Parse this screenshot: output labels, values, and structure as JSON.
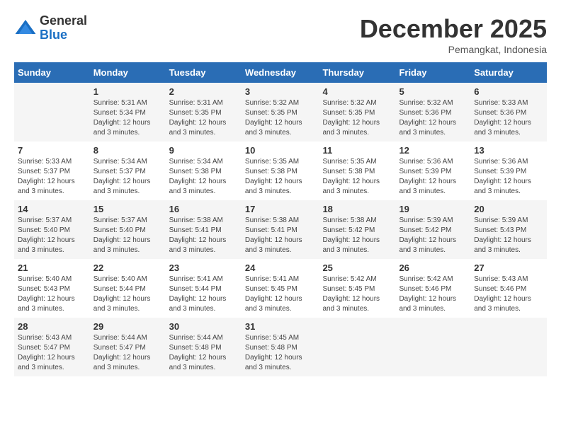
{
  "logo": {
    "general": "General",
    "blue": "Blue"
  },
  "title": "December 2025",
  "location": "Pemangkat, Indonesia",
  "days_header": [
    "Sunday",
    "Monday",
    "Tuesday",
    "Wednesday",
    "Thursday",
    "Friday",
    "Saturday"
  ],
  "rows": [
    [
      {
        "num": "",
        "info": ""
      },
      {
        "num": "1",
        "info": "Sunrise: 5:31 AM\nSunset: 5:34 PM\nDaylight: 12 hours\nand 3 minutes."
      },
      {
        "num": "2",
        "info": "Sunrise: 5:31 AM\nSunset: 5:35 PM\nDaylight: 12 hours\nand 3 minutes."
      },
      {
        "num": "3",
        "info": "Sunrise: 5:32 AM\nSunset: 5:35 PM\nDaylight: 12 hours\nand 3 minutes."
      },
      {
        "num": "4",
        "info": "Sunrise: 5:32 AM\nSunset: 5:35 PM\nDaylight: 12 hours\nand 3 minutes."
      },
      {
        "num": "5",
        "info": "Sunrise: 5:32 AM\nSunset: 5:36 PM\nDaylight: 12 hours\nand 3 minutes."
      },
      {
        "num": "6",
        "info": "Sunrise: 5:33 AM\nSunset: 5:36 PM\nDaylight: 12 hours\nand 3 minutes."
      }
    ],
    [
      {
        "num": "7",
        "info": "Sunrise: 5:33 AM\nSunset: 5:37 PM\nDaylight: 12 hours\nand 3 minutes."
      },
      {
        "num": "8",
        "info": "Sunrise: 5:34 AM\nSunset: 5:37 PM\nDaylight: 12 hours\nand 3 minutes."
      },
      {
        "num": "9",
        "info": "Sunrise: 5:34 AM\nSunset: 5:38 PM\nDaylight: 12 hours\nand 3 minutes."
      },
      {
        "num": "10",
        "info": "Sunrise: 5:35 AM\nSunset: 5:38 PM\nDaylight: 12 hours\nand 3 minutes."
      },
      {
        "num": "11",
        "info": "Sunrise: 5:35 AM\nSunset: 5:38 PM\nDaylight: 12 hours\nand 3 minutes."
      },
      {
        "num": "12",
        "info": "Sunrise: 5:36 AM\nSunset: 5:39 PM\nDaylight: 12 hours\nand 3 minutes."
      },
      {
        "num": "13",
        "info": "Sunrise: 5:36 AM\nSunset: 5:39 PM\nDaylight: 12 hours\nand 3 minutes."
      }
    ],
    [
      {
        "num": "14",
        "info": "Sunrise: 5:37 AM\nSunset: 5:40 PM\nDaylight: 12 hours\nand 3 minutes."
      },
      {
        "num": "15",
        "info": "Sunrise: 5:37 AM\nSunset: 5:40 PM\nDaylight: 12 hours\nand 3 minutes."
      },
      {
        "num": "16",
        "info": "Sunrise: 5:38 AM\nSunset: 5:41 PM\nDaylight: 12 hours\nand 3 minutes."
      },
      {
        "num": "17",
        "info": "Sunrise: 5:38 AM\nSunset: 5:41 PM\nDaylight: 12 hours\nand 3 minutes."
      },
      {
        "num": "18",
        "info": "Sunrise: 5:38 AM\nSunset: 5:42 PM\nDaylight: 12 hours\nand 3 minutes."
      },
      {
        "num": "19",
        "info": "Sunrise: 5:39 AM\nSunset: 5:42 PM\nDaylight: 12 hours\nand 3 minutes."
      },
      {
        "num": "20",
        "info": "Sunrise: 5:39 AM\nSunset: 5:43 PM\nDaylight: 12 hours\nand 3 minutes."
      }
    ],
    [
      {
        "num": "21",
        "info": "Sunrise: 5:40 AM\nSunset: 5:43 PM\nDaylight: 12 hours\nand 3 minutes."
      },
      {
        "num": "22",
        "info": "Sunrise: 5:40 AM\nSunset: 5:44 PM\nDaylight: 12 hours\nand 3 minutes."
      },
      {
        "num": "23",
        "info": "Sunrise: 5:41 AM\nSunset: 5:44 PM\nDaylight: 12 hours\nand 3 minutes."
      },
      {
        "num": "24",
        "info": "Sunrise: 5:41 AM\nSunset: 5:45 PM\nDaylight: 12 hours\nand 3 minutes."
      },
      {
        "num": "25",
        "info": "Sunrise: 5:42 AM\nSunset: 5:45 PM\nDaylight: 12 hours\nand 3 minutes."
      },
      {
        "num": "26",
        "info": "Sunrise: 5:42 AM\nSunset: 5:46 PM\nDaylight: 12 hours\nand 3 minutes."
      },
      {
        "num": "27",
        "info": "Sunrise: 5:43 AM\nSunset: 5:46 PM\nDaylight: 12 hours\nand 3 minutes."
      }
    ],
    [
      {
        "num": "28",
        "info": "Sunrise: 5:43 AM\nSunset: 5:47 PM\nDaylight: 12 hours\nand 3 minutes."
      },
      {
        "num": "29",
        "info": "Sunrise: 5:44 AM\nSunset: 5:47 PM\nDaylight: 12 hours\nand 3 minutes."
      },
      {
        "num": "30",
        "info": "Sunrise: 5:44 AM\nSunset: 5:48 PM\nDaylight: 12 hours\nand 3 minutes."
      },
      {
        "num": "31",
        "info": "Sunrise: 5:45 AM\nSunset: 5:48 PM\nDaylight: 12 hours\nand 3 minutes."
      },
      {
        "num": "",
        "info": ""
      },
      {
        "num": "",
        "info": ""
      },
      {
        "num": "",
        "info": ""
      }
    ]
  ]
}
